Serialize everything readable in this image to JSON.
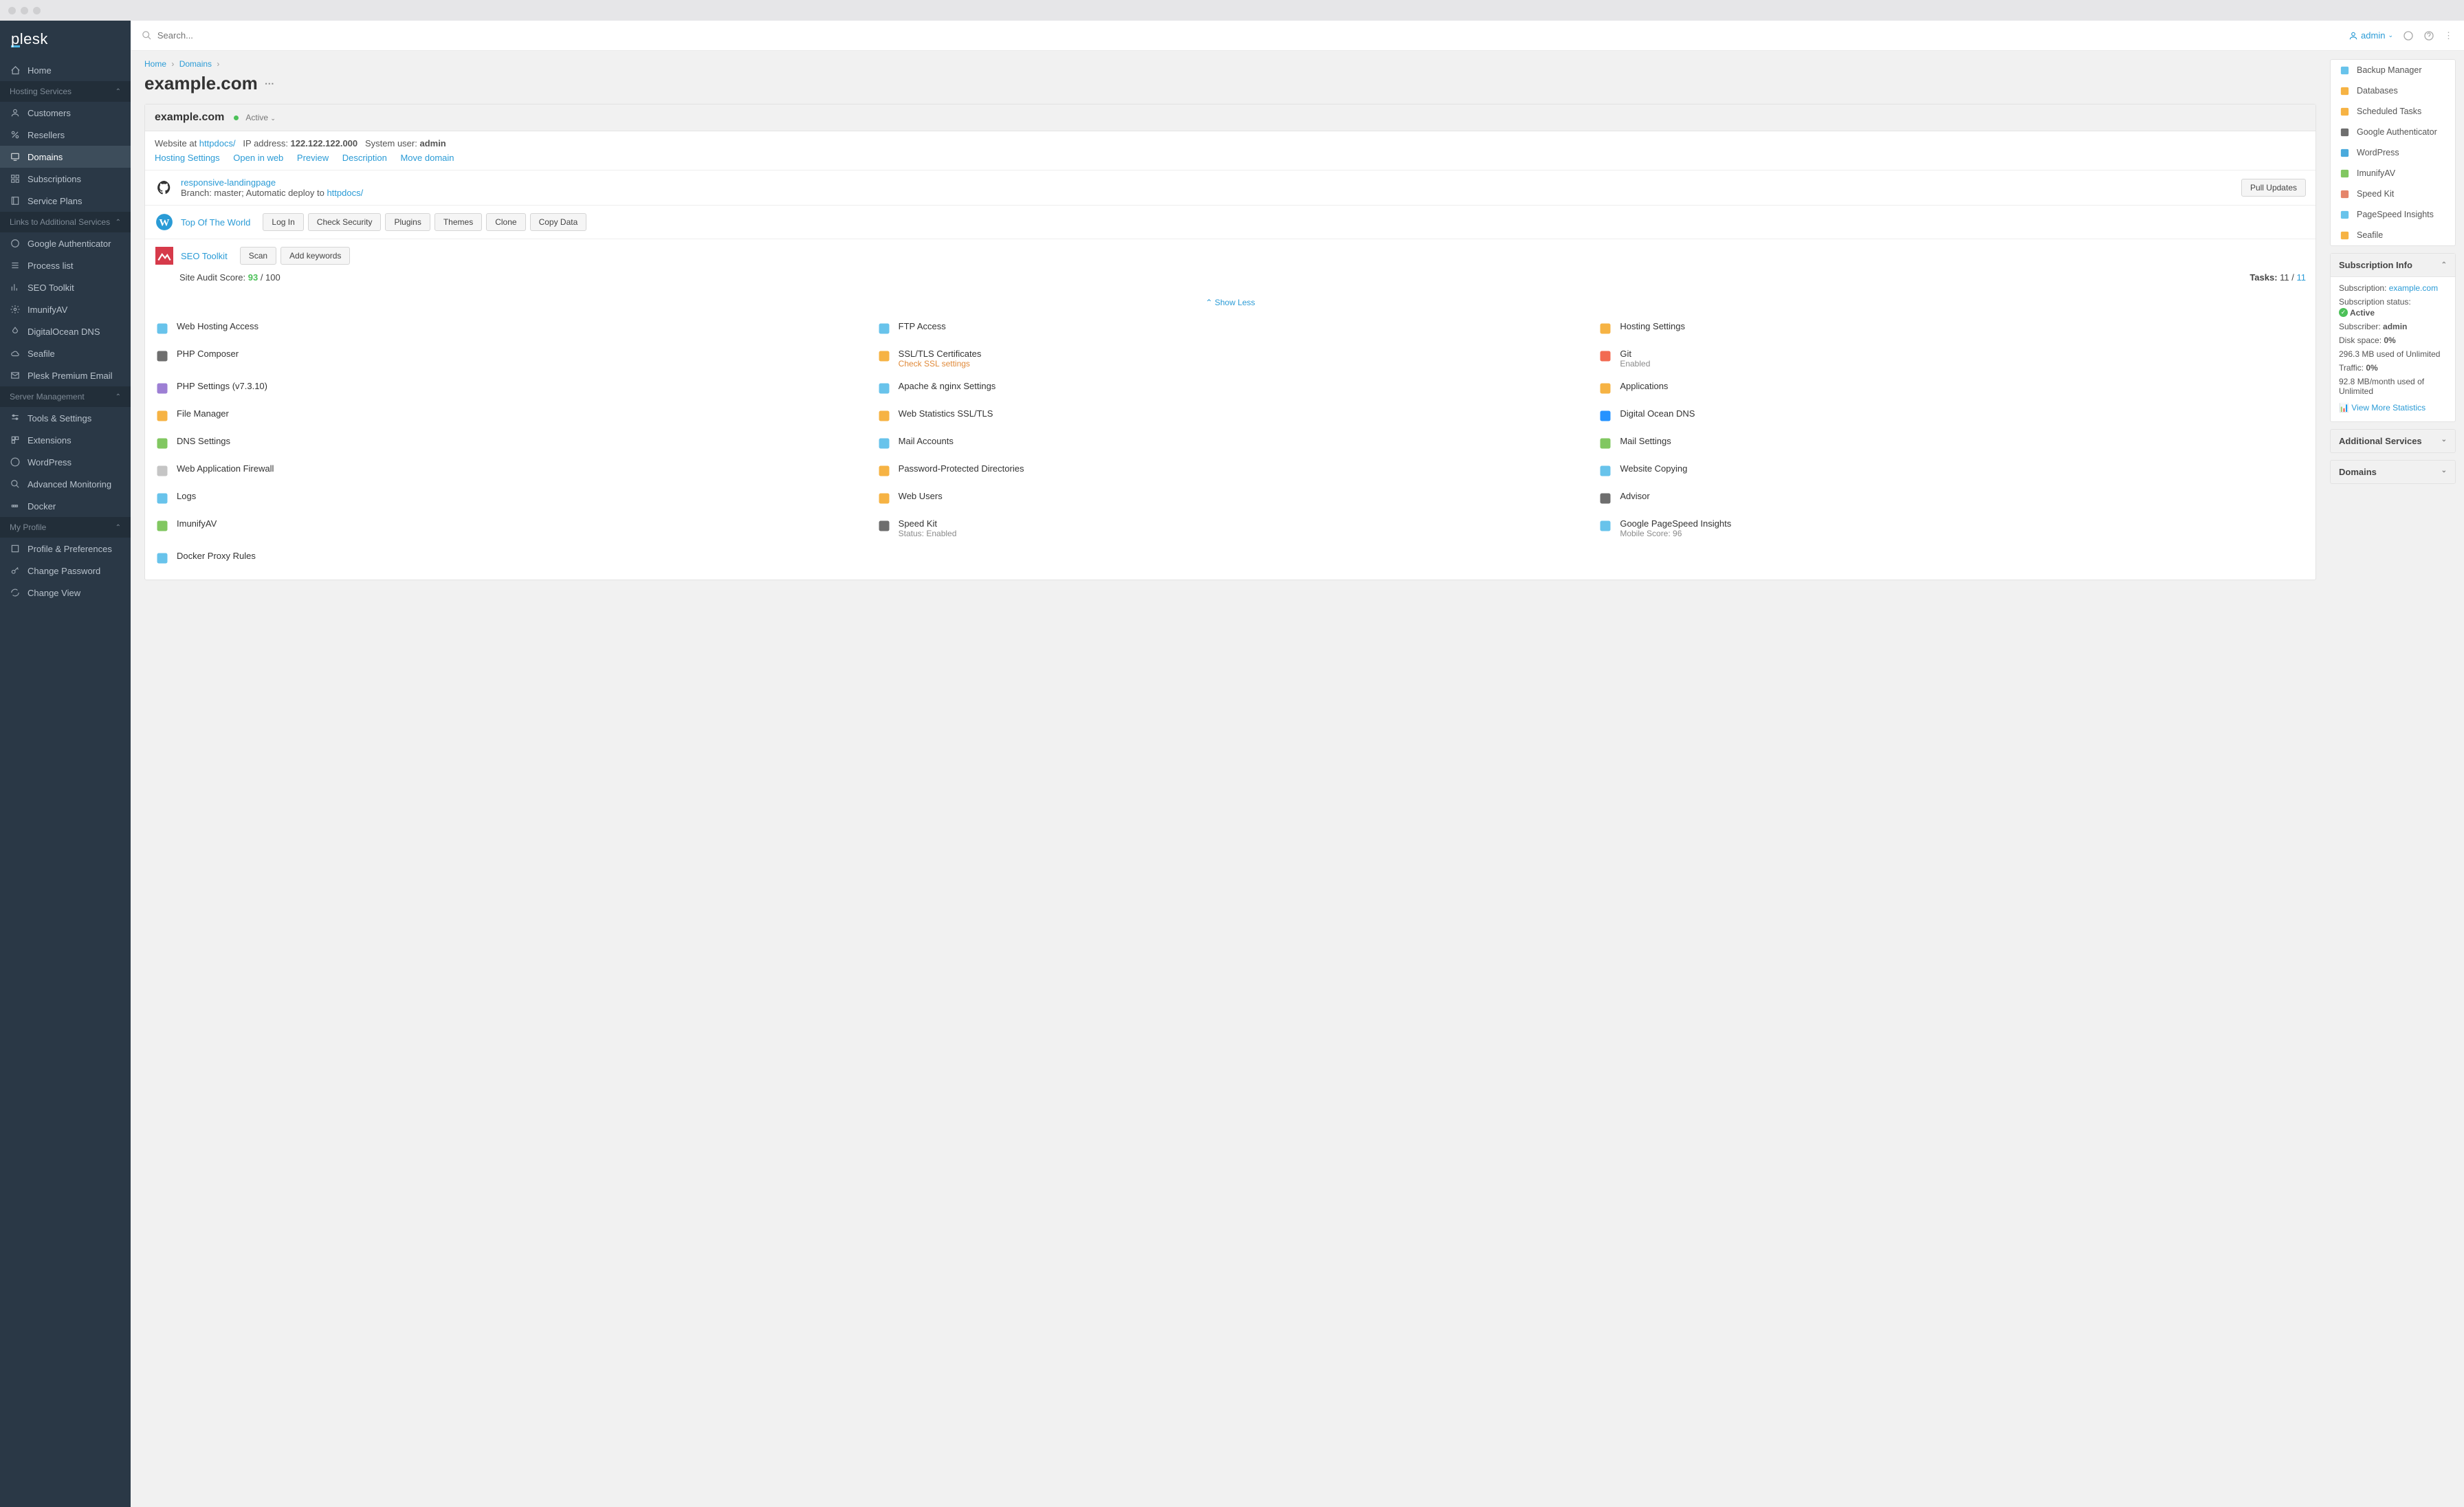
{
  "logo": "plesk",
  "search": {
    "placeholder": "Search..."
  },
  "user": {
    "name": "admin"
  },
  "nav": {
    "home": "Home",
    "sections": {
      "hosting": {
        "label": "Hosting Services",
        "items": [
          "Customers",
          "Resellers",
          "Domains",
          "Subscriptions",
          "Service Plans"
        ]
      },
      "links": {
        "label": "Links to Additional Services",
        "items": [
          "Google Authenticator",
          "Process list",
          "SEO Toolkit",
          "ImunifyAV",
          "DigitalOcean DNS",
          "Seafile",
          "Plesk Premium Email"
        ]
      },
      "server": {
        "label": "Server Management",
        "items": [
          "Tools & Settings",
          "Extensions",
          "WordPress",
          "Advanced Monitoring",
          "Docker"
        ]
      },
      "profile": {
        "label": "My Profile",
        "items": [
          "Profile & Preferences",
          "Change Password",
          "Change View"
        ]
      }
    }
  },
  "breadcrumb": {
    "home": "Home",
    "domains": "Domains"
  },
  "page": {
    "title": "example.com"
  },
  "domain": {
    "name": "example.com",
    "status": "Active",
    "website_at_label": "Website at ",
    "website_at_link": "httpdocs/",
    "ip_label": "IP address: ",
    "ip": "122.122.122.000",
    "sysuser_label": "System user: ",
    "sysuser": "admin",
    "links": [
      "Hosting Settings",
      "Open in web",
      "Preview",
      "Description",
      "Move domain"
    ]
  },
  "git": {
    "repo": "responsive-landingpage",
    "branch_line_a": "Branch: master; Automatic deploy to ",
    "branch_link": "httpdocs/",
    "pull_btn": "Pull Updates"
  },
  "wp": {
    "name": "Top Of The World",
    "buttons": [
      "Log In",
      "Check Security",
      "Plugins",
      "Themes",
      "Clone",
      "Copy Data"
    ]
  },
  "seo": {
    "name": "SEO Toolkit",
    "buttons": [
      "Scan",
      "Add keywords"
    ],
    "audit_label": "Site Audit Score: ",
    "audit_score": "93",
    "audit_total": " / 100",
    "tasks_label": "Tasks: ",
    "tasks_done": "11",
    "tasks_sep": " /  ",
    "tasks_total": "11"
  },
  "show_less": "Show Less",
  "tools": [
    {
      "name": "Web Hosting Access",
      "icon": "globe",
      "color": "#4db8e8"
    },
    {
      "name": "FTP Access",
      "icon": "screen",
      "color": "#4db8e8"
    },
    {
      "name": "Hosting Settings",
      "icon": "server",
      "color": "#f5a623"
    },
    {
      "name": "PHP Composer",
      "icon": "composer",
      "color": "#555"
    },
    {
      "name": "SSL/TLS Certificates",
      "sub": "Check SSL settings",
      "subwarn": true,
      "icon": "lock",
      "color": "#f5a623"
    },
    {
      "name": "Git",
      "sub": "Enabled",
      "icon": "git",
      "color": "#f05033"
    },
    {
      "name": "PHP Settings (v7.3.10)",
      "icon": "php",
      "color": "#8c68cd"
    },
    {
      "name": "Apache & nginx Settings",
      "icon": "apache",
      "color": "#4db8e8"
    },
    {
      "name": "Applications",
      "icon": "apps",
      "color": "#f5a623"
    },
    {
      "name": "File Manager",
      "icon": "folder",
      "color": "#f5a623"
    },
    {
      "name": "Web Statistics SSL/TLS",
      "icon": "stats",
      "color": "#f5a623"
    },
    {
      "name": "Digital Ocean DNS",
      "icon": "do",
      "color": "#0080ff"
    },
    {
      "name": "DNS Settings",
      "icon": "flag",
      "color": "#6bbd45"
    },
    {
      "name": "Mail Accounts",
      "icon": "mail",
      "color": "#4db8e8"
    },
    {
      "name": "Mail Settings",
      "icon": "mailset",
      "color": "#6bbd45"
    },
    {
      "name": "Web Application Firewall",
      "icon": "shield",
      "color": "#bbb"
    },
    {
      "name": "Password-Protected Directories",
      "icon": "pfolder",
      "color": "#f5a623"
    },
    {
      "name": "Website Copying",
      "icon": "copy",
      "color": "#4db8e8"
    },
    {
      "name": "Logs",
      "icon": "logs",
      "color": "#4db8e8"
    },
    {
      "name": "Web Users",
      "icon": "users",
      "color": "#f5a623"
    },
    {
      "name": "Advisor",
      "icon": "advisor",
      "color": "#555"
    },
    {
      "name": "ImunifyAV",
      "icon": "imunify",
      "color": "#6bbd45"
    },
    {
      "name": "Speed Kit",
      "sub": "Status: Enabled",
      "icon": "speed",
      "color": "#555"
    },
    {
      "name": "Google PageSpeed Insights",
      "sub": "Mobile Score: 96",
      "icon": "pagespeed",
      "color": "#4db8e8"
    },
    {
      "name": "Docker Proxy Rules",
      "icon": "docker",
      "color": "#4db8e8"
    }
  ],
  "right_quick": [
    {
      "name": "Backup Manager",
      "color": "#4db8e8"
    },
    {
      "name": "Databases",
      "color": "#f5a623"
    },
    {
      "name": "Scheduled Tasks",
      "color": "#f5a623"
    },
    {
      "name": "Google Authenticator",
      "color": "#555"
    },
    {
      "name": "WordPress",
      "color": "#2a9bd6"
    },
    {
      "name": "ImunifyAV",
      "color": "#6bbd45"
    },
    {
      "name": "Speed Kit",
      "color": "#e07050"
    },
    {
      "name": "PageSpeed Insights",
      "color": "#4db8e8"
    },
    {
      "name": "Seafile",
      "color": "#f5a623"
    }
  ],
  "sub_info": {
    "title": "Subscription Info",
    "subscription_label": "Subscription: ",
    "subscription_link": "example.com",
    "status_label": "Subscription status: ",
    "status": "Active",
    "subscriber_label": "Subscriber: ",
    "subscriber": "admin",
    "disk_label": "Disk space: ",
    "disk_pct": "0%",
    "disk_used": "296.3 MB used of Unlimited",
    "traffic_label": "Traffic: ",
    "traffic_pct": "0%",
    "traffic_used": "92.8 MB/month used of Unlimited",
    "more_stats": "View More Statistics"
  },
  "additional_services": "Additional Services",
  "domains_panel": "Domains"
}
